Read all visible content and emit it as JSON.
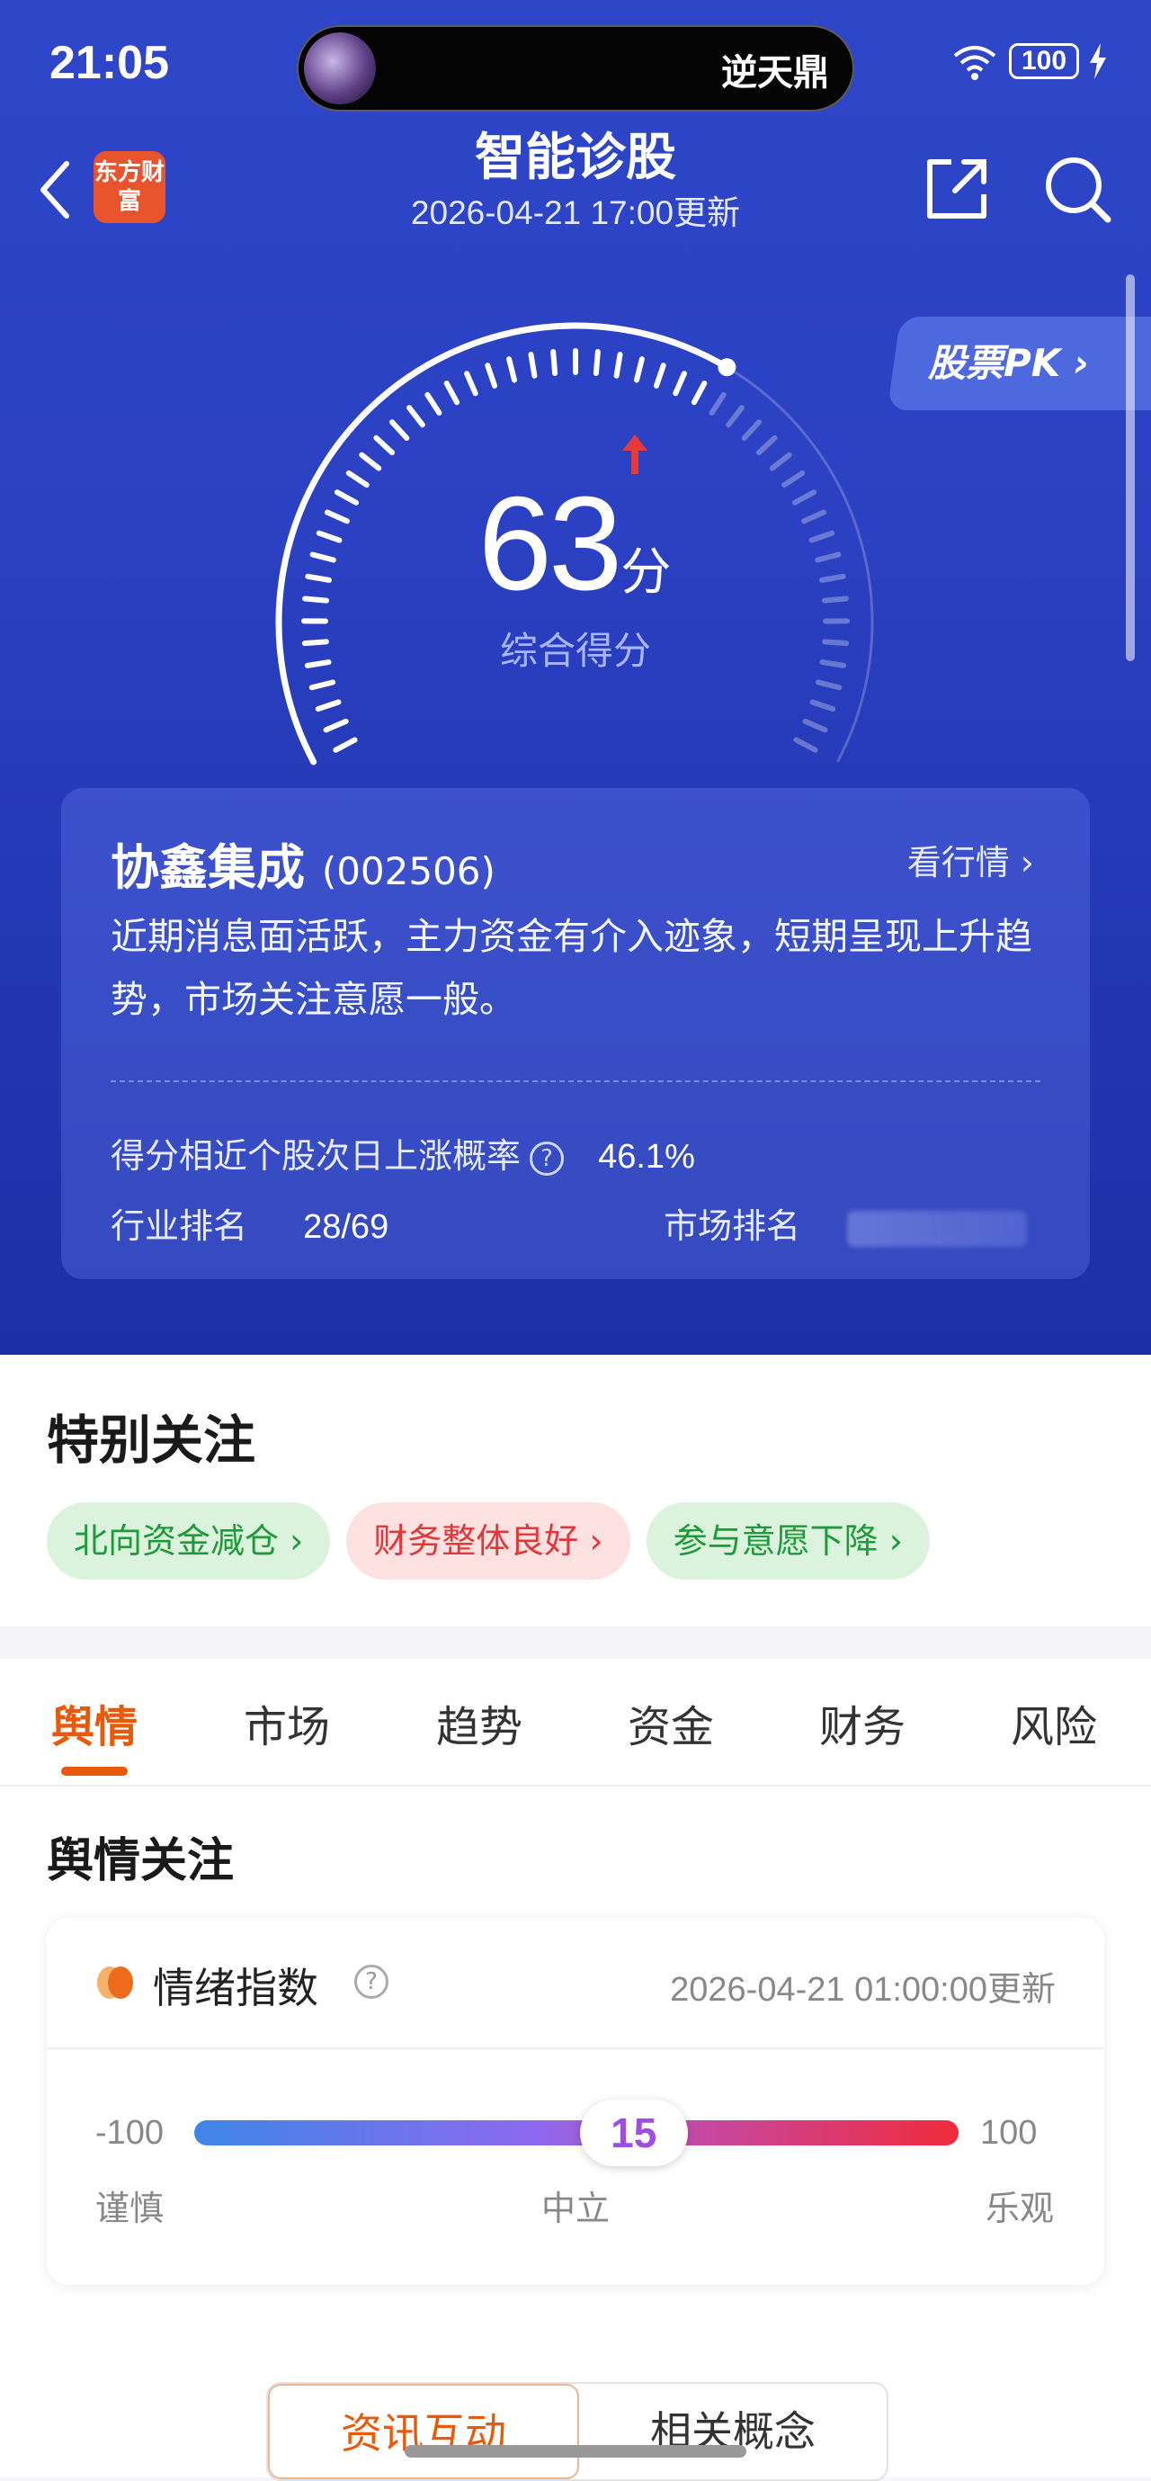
{
  "status_bar": {
    "time": "21:05",
    "island_text": "逆天鼎",
    "battery": "100"
  },
  "header": {
    "title": "智能诊股",
    "subtitle": "2026-04-21 17:00更新",
    "logo_text": "东方财富"
  },
  "pk_button": "股票PK",
  "score": {
    "value": "63",
    "unit": "分",
    "label": "综合得分",
    "level": 0.63
  },
  "stock_card": {
    "name": "协鑫集成",
    "code": "(002506)",
    "link": "看行情",
    "description": "近期消息面活跃，主力资金有介入迹象，短期呈现上升趋势，市场关注意愿一般。",
    "prob_label": "得分相近个股次日上涨概率",
    "prob_value": "46.1%",
    "industry_rank_label": "行业排名",
    "industry_rank_value": "28/69",
    "market_rank_label": "市场排名"
  },
  "special_attention": {
    "title": "特别关注",
    "tags": [
      {
        "label": "北向资金减仓",
        "color": "green"
      },
      {
        "label": "财务整体良好",
        "color": "red"
      },
      {
        "label": "参与意愿下降",
        "color": "green"
      }
    ]
  },
  "tabs": [
    "舆情",
    "市场",
    "趋势",
    "资金",
    "财务",
    "风险"
  ],
  "sentiment": {
    "section_title": "舆情关注",
    "card_title": "情绪指数",
    "updated": "2026-04-21 01:00:00更新",
    "min": "-100",
    "max": "100",
    "value": "15",
    "value_fraction": 0.575,
    "left_label": "谨慎",
    "mid_label": "中立",
    "right_label": "乐观"
  },
  "bottom_tabs": [
    "资讯互动",
    "相关概念"
  ],
  "colors": {
    "accent": "#e8590c",
    "hero_blue": "#2b40c2"
  }
}
